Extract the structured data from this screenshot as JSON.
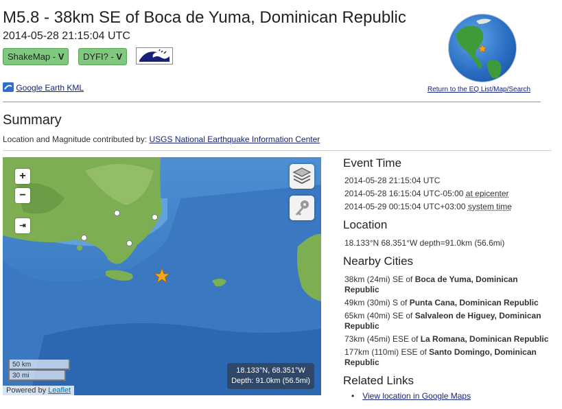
{
  "header": {
    "title": "M5.8 - 38km SE of Boca de Yuma, Dominican Republic",
    "datetime": "2014-05-28 21:15:04 UTC",
    "badges": [
      {
        "label": "ShakeMap - ",
        "value": "V"
      },
      {
        "label": "DYFI? - ",
        "value": "V"
      }
    ],
    "kml_label": "Google Earth KML",
    "return_link": "Return to the EQ List/Map/Search"
  },
  "summary": {
    "heading": "Summary",
    "contrib_prefix": "Location and Magnitude contributed by: ",
    "contrib_link": "USGS National Earthquake Information Center"
  },
  "map": {
    "zoom_in": "+",
    "zoom_out": "−",
    "scale_km": "50 km",
    "scale_mi": "30 mi",
    "powered_by": "Powered by ",
    "leaflet": "Leaflet",
    "coords": "18.133°N, 68.351°W",
    "depth": "Depth: 91.0km (56.5mi)"
  },
  "event_time": {
    "heading": "Event Time",
    "utc": "2014-05-28 21:15:04 UTC",
    "local": "2014-05-28 16:15:04 UTC-05:00",
    "local_suffix": "at epicenter",
    "system": "2014-05-29 00:15:04 UTC+03:00",
    "system_suffix": "system time"
  },
  "location": {
    "heading": "Location",
    "text": "18.133°N 68.351°W depth=91.0km (56.6mi)"
  },
  "nearby": {
    "heading": "Nearby Cities",
    "cities": [
      {
        "dist": "38km (24mi) SE of ",
        "name": "Boca de Yuma, Dominican Republic"
      },
      {
        "dist": "49km (30mi) S of ",
        "name": "Punta Cana, Dominican Republic"
      },
      {
        "dist": "65km (40mi) SE of ",
        "name": "Salvaleon de Higuey, Dominican Republic"
      },
      {
        "dist": "73km (45mi) ESE of ",
        "name": "La Romana, Dominican Republic"
      },
      {
        "dist": "177km (110mi) ESE of ",
        "name": "Santo Domingo, Dominican Republic"
      }
    ]
  },
  "related": {
    "heading": "Related Links",
    "link": "View location in Google Maps"
  }
}
